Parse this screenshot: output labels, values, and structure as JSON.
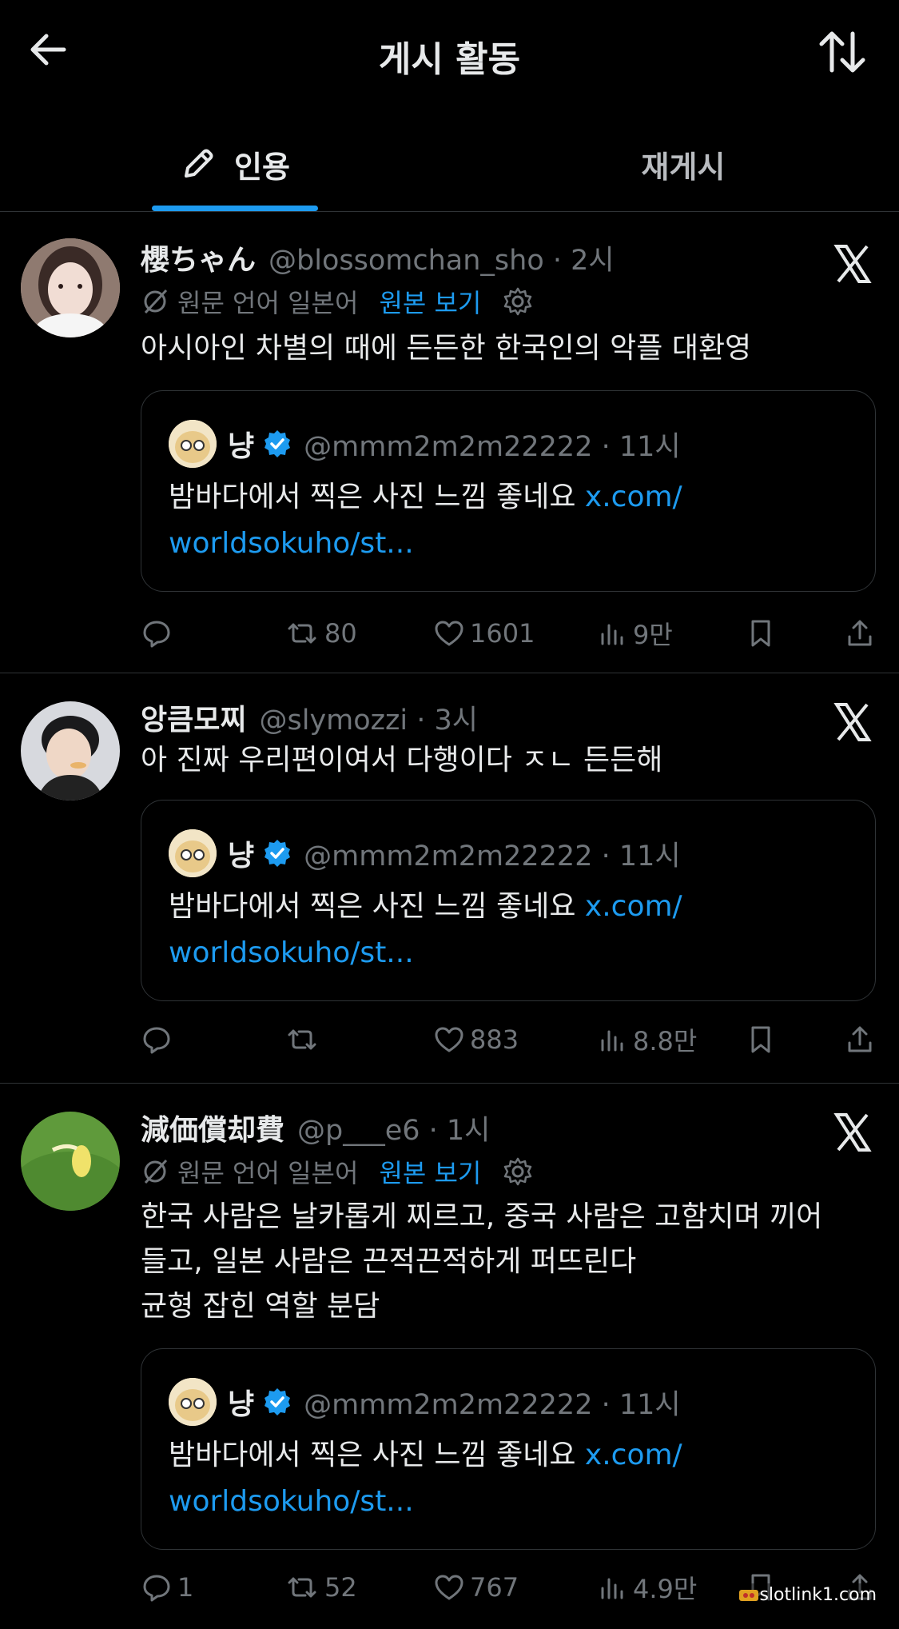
{
  "header": {
    "title": "게시 활동"
  },
  "tabs": [
    {
      "label": "인용",
      "active": true
    },
    {
      "label": "재게시",
      "active": false
    }
  ],
  "colors": {
    "accent": "#1d9bf0",
    "muted": "#71767b",
    "background": "#000000"
  },
  "posts": [
    {
      "name": "櫻ちゃん",
      "meta": "@blossomchan_sho · 2시",
      "translation": {
        "label": "원문 언어 일본어",
        "link": "원본 보기"
      },
      "text": "아시아인 차별의 때에 든든한 한국인의 악플 대환영",
      "quote": {
        "name": "냥",
        "meta": "@mmm2m2m22222 · 11시",
        "text": "밤바다에서 찍은 사진 느낌 좋네요 ",
        "link": "x.com/ worldsokuho/st..."
      },
      "actions": {
        "reply": "",
        "repost": "80",
        "like": "1601",
        "views": "9만"
      }
    },
    {
      "name": "앙큼모찌",
      "meta": "@slymozzi · 3시",
      "text": "아 진짜 우리편이여서 다행이다 ㅈㄴ 든든해",
      "quote": {
        "name": "냥",
        "meta": "@mmm2m2m22222 · 11시",
        "text": "밤바다에서 찍은 사진 느낌 좋네요 ",
        "link": "x.com/ worldsokuho/st..."
      },
      "actions": {
        "reply": "",
        "repost": "",
        "like": "883",
        "views": "8.8만"
      }
    },
    {
      "name": "減価償却費",
      "meta": "@p___e6 · 1시",
      "translation": {
        "label": "원문 언어 일본어",
        "link": "원본 보기"
      },
      "text_lines": [
        "한국 사람은 날카롭게 찌르고, 중국 사람은 고함치며 끼어",
        "들고, 일본 사람은 끈적끈적하게 퍼뜨린다",
        "균형 잡힌 역할 분담"
      ],
      "quote": {
        "name": "냥",
        "meta": "@mmm2m2m22222 · 11시",
        "text": "밤바다에서 찍은 사진 느낌 좋네요 ",
        "link": "x.com/ worldsokuho/st..."
      },
      "actions": {
        "reply": "1",
        "repost": "52",
        "like": "767",
        "views": "4.9만"
      }
    }
  ],
  "watermark": "slotlink1.com"
}
